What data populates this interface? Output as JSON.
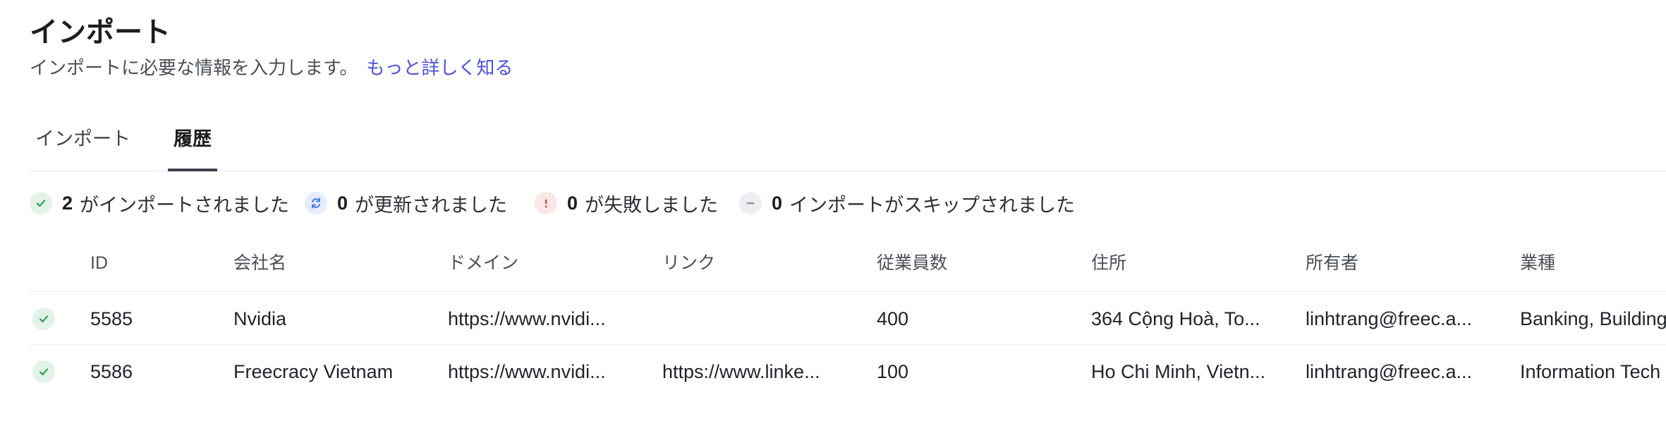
{
  "header": {
    "title": "インポート",
    "subtitle": "インポートに必要な情報を入力します。",
    "learn_more": "もっと詳しく知る"
  },
  "tabs": [
    {
      "label": "インポート",
      "active": false
    },
    {
      "label": "履歴",
      "active": true
    }
  ],
  "stats": {
    "imported": {
      "count": "2",
      "label": "がインポートされました"
    },
    "updated": {
      "count": "0",
      "label": "が更新されました"
    },
    "failed": {
      "count": "0",
      "label": "が失敗しました"
    },
    "skipped": {
      "count": "0",
      "label": "インポートがスキップされました"
    }
  },
  "table": {
    "columns": [
      "ID",
      "会社名",
      "ドメイン",
      "リンク",
      "従業員数",
      "住所",
      "所有者",
      "業種"
    ],
    "rows": [
      {
        "status": "success",
        "id": "5585",
        "company": "Nvidia",
        "domain": "https://www.nvidi...",
        "link": "",
        "employees": "400",
        "address": "364 Cộng Hoà, To...",
        "owner": "linhtrang@freec.a...",
        "industry": "Banking, Building"
      },
      {
        "status": "success",
        "id": "5586",
        "company": "Freecracy Vietnam",
        "domain": "https://www.nvidi...",
        "link": "https://www.linke...",
        "employees": "100",
        "address": "Ho Chi Minh, Vietn...",
        "owner": "linhtrang@freec.a...",
        "industry": "Information Tech"
      }
    ]
  },
  "colors": {
    "accent_link": "#4a4fdf",
    "success": "#3fa463",
    "update": "#4c7be8",
    "fail": "#d94848",
    "skip": "#8a919c"
  }
}
